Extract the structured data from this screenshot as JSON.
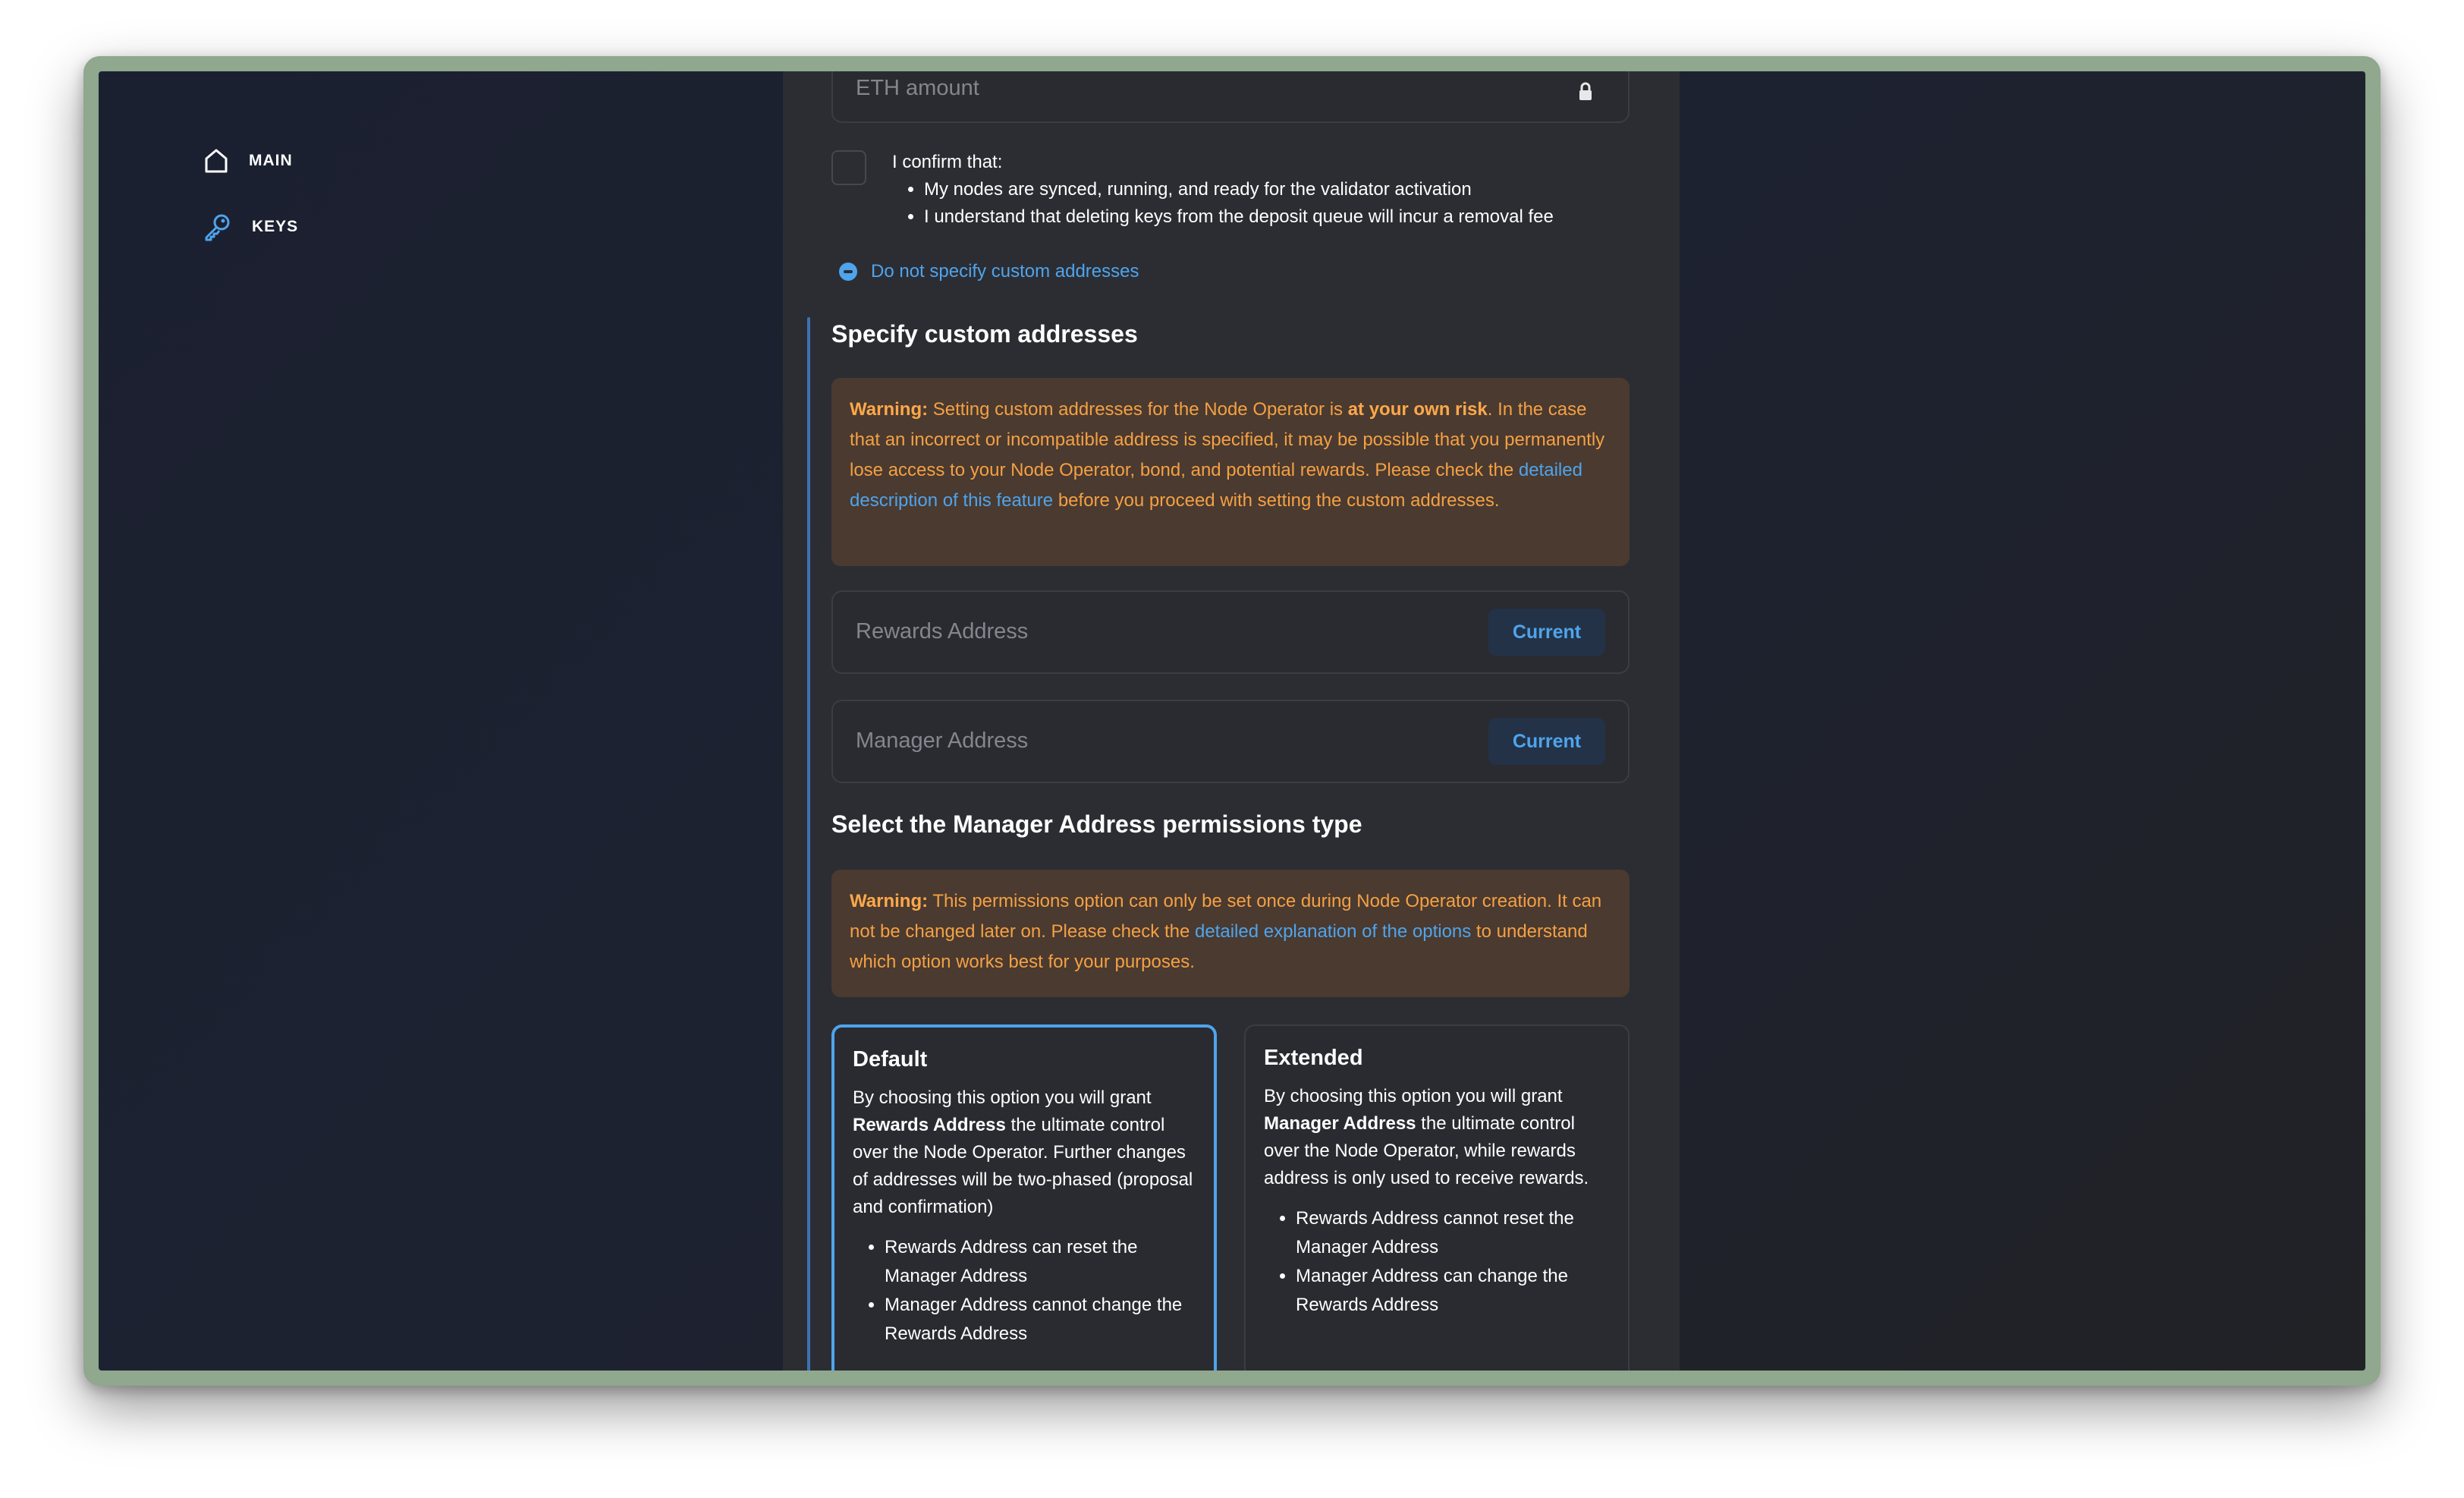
{
  "sidebar": {
    "items": [
      {
        "label": "MAIN",
        "icon": "home-icon"
      },
      {
        "label": "KEYS",
        "icon": "key-icon"
      }
    ]
  },
  "form": {
    "eth_amount_placeholder": "ETH amount",
    "confirm": {
      "label": "I confirm that:",
      "items": [
        "My nodes are synced, running, and ready for the validator activation",
        "I understand that deleting keys from the deposit queue will incur a removal fee"
      ]
    },
    "toggle_custom_label": "Do not specify custom addresses",
    "custom_title": "Specify custom addresses",
    "warning1": {
      "prefix": "Warning:",
      "t1": " Setting custom addresses for the Node Operator is ",
      "bold": "at your own risk",
      "t2": ". In the case that an incorrect or incompatible address is specified, it may be possible that you permanently lose access to your Node Operator, bond, and potential rewards. Please check the ",
      "link": "detailed description of this feature",
      "t3": " before you proceed with setting the custom addresses."
    },
    "rewards_placeholder": "Rewards Address",
    "manager_placeholder": "Manager Address",
    "current_label": "Current",
    "permissions_title": "Select the Manager Address permissions type",
    "warning2": {
      "prefix": "Warning:",
      "t1": " This permissions option can only be set once during Node Operator creation. It can not be changed later on. Please check the ",
      "link": "detailed explanation of the options",
      "t2": " to understand which option works best for your purposes."
    },
    "options": [
      {
        "title": "Default",
        "desc_pre": "By choosing this option you will grant ",
        "desc_bold": "Rewards Address",
        "desc_post": " the ultimate control over the Node Operator. Further changes of addresses will be two-phased (proposal and confirmation)",
        "bullets": [
          "Rewards Address can reset the Manager Address",
          "Manager Address cannot change the Rewards Address"
        ]
      },
      {
        "title": "Extended",
        "desc_pre": "By choosing this option you will grant ",
        "desc_bold": "Manager Address",
        "desc_post": " the ultimate control over the Node Operator, while rewards address is only used to receive rewards.",
        "bullets": [
          "Rewards Address cannot reset the Manager Address",
          "Manager Address can change the Rewards Address"
        ]
      }
    ]
  },
  "colors": {
    "accent": "#4fa4ec",
    "warning_text": "#f5a043",
    "panel": "#2c2d33"
  }
}
